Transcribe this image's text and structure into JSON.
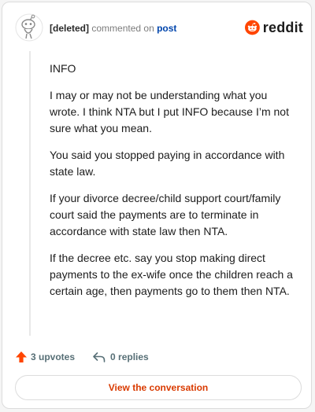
{
  "header": {
    "username": "[deleted]",
    "action_text": "commented on",
    "target_text": "post",
    "brand_wordmark": "reddit"
  },
  "comment": {
    "paragraphs": [
      "INFO",
      "I may or may not be understanding what you wrote. I think NTA but I put INFO because I’m not sure what you mean.",
      "You said you stopped paying in accordance with state law.",
      "If your divorce decree/child support court/family court said the payments are to terminate in accordance with state law then NTA.",
      "If the decree etc. say you stop making direct payments to the ex-wife once the children reach a certain age, then payments go to them then NTA."
    ]
  },
  "stats": {
    "upvotes_label": "3 upvotes",
    "replies_label": "0 replies"
  },
  "cta": {
    "label": "View the conversation"
  },
  "colors": {
    "brand": "#ff4500",
    "link": "#0045ac",
    "cta_text": "#d93a00",
    "muted": "#576f76"
  },
  "icons": {
    "avatar": "snoo-avatar-icon",
    "brand": "reddit-logo-icon",
    "upvote": "upvote-arrow-icon",
    "reply": "reply-arrow-icon"
  }
}
